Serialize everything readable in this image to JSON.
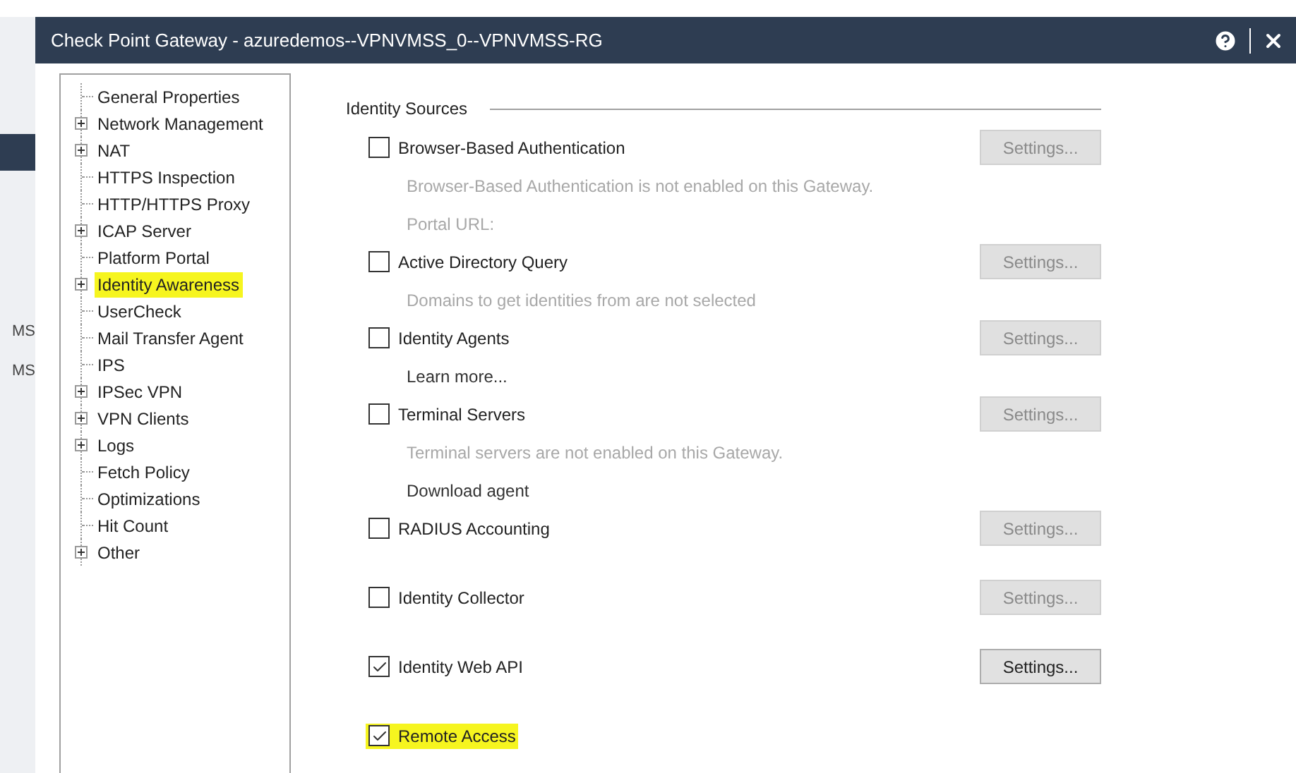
{
  "background": {
    "fragments": [
      "MS",
      "MS"
    ]
  },
  "window": {
    "title": "Check Point Gateway - azuredemos--VPNVMSS_0--VPNVMSS-RG"
  },
  "tree": [
    {
      "label": "General Properties",
      "expandable": false,
      "highlighted": false
    },
    {
      "label": "Network Management",
      "expandable": true,
      "highlighted": false
    },
    {
      "label": "NAT",
      "expandable": true,
      "highlighted": false
    },
    {
      "label": "HTTPS Inspection",
      "expandable": false,
      "highlighted": false
    },
    {
      "label": "HTTP/HTTPS Proxy",
      "expandable": false,
      "highlighted": false
    },
    {
      "label": "ICAP Server",
      "expandable": true,
      "highlighted": false
    },
    {
      "label": "Platform Portal",
      "expandable": false,
      "highlighted": false
    },
    {
      "label": "Identity Awareness",
      "expandable": true,
      "highlighted": true
    },
    {
      "label": "UserCheck",
      "expandable": false,
      "highlighted": false
    },
    {
      "label": "Mail Transfer Agent",
      "expandable": false,
      "highlighted": false
    },
    {
      "label": "IPS",
      "expandable": false,
      "highlighted": false
    },
    {
      "label": "IPSec VPN",
      "expandable": true,
      "highlighted": false
    },
    {
      "label": "VPN Clients",
      "expandable": true,
      "highlighted": false
    },
    {
      "label": "Logs",
      "expandable": true,
      "highlighted": false
    },
    {
      "label": "Fetch Policy",
      "expandable": false,
      "highlighted": false
    },
    {
      "label": "Optimizations",
      "expandable": false,
      "highlighted": false
    },
    {
      "label": "Hit Count",
      "expandable": false,
      "highlighted": false
    },
    {
      "label": "Other",
      "expandable": true,
      "highlighted": false
    }
  ],
  "section": {
    "title": "Identity Sources"
  },
  "sources": [
    {
      "label": "Browser-Based Authentication",
      "checked": false,
      "highlighted": false,
      "settings": {
        "label": "Settings...",
        "disabled": true
      },
      "notes": [
        {
          "text": "Browser-Based Authentication is not enabled on this Gateway.",
          "disabled": true
        },
        {
          "text": "Portal URL:",
          "disabled": true
        }
      ]
    },
    {
      "label": "Active Directory Query",
      "checked": false,
      "highlighted": false,
      "settings": {
        "label": "Settings...",
        "disabled": true
      },
      "notes": [
        {
          "text": "Domains to get identities from are not selected",
          "disabled": true
        }
      ]
    },
    {
      "label": "Identity Agents",
      "checked": false,
      "highlighted": false,
      "settings": {
        "label": "Settings...",
        "disabled": true
      },
      "notes": [
        {
          "text": "Learn more...",
          "disabled": false
        }
      ]
    },
    {
      "label": "Terminal Servers",
      "checked": false,
      "highlighted": false,
      "settings": {
        "label": "Settings...",
        "disabled": true
      },
      "notes": [
        {
          "text": "Terminal servers are not enabled on this Gateway.",
          "disabled": true
        },
        {
          "text": "Download agent",
          "disabled": false
        }
      ]
    },
    {
      "label": "RADIUS Accounting",
      "checked": false,
      "highlighted": false,
      "settings": {
        "label": "Settings...",
        "disabled": true
      }
    },
    {
      "label": "Identity Collector",
      "checked": false,
      "highlighted": false,
      "settings": {
        "label": "Settings...",
        "disabled": true
      }
    },
    {
      "label": "Identity Web API",
      "checked": true,
      "highlighted": false,
      "settings": {
        "label": "Settings...",
        "disabled": false
      }
    },
    {
      "label": "Remote Access",
      "checked": true,
      "highlighted": true
    }
  ]
}
